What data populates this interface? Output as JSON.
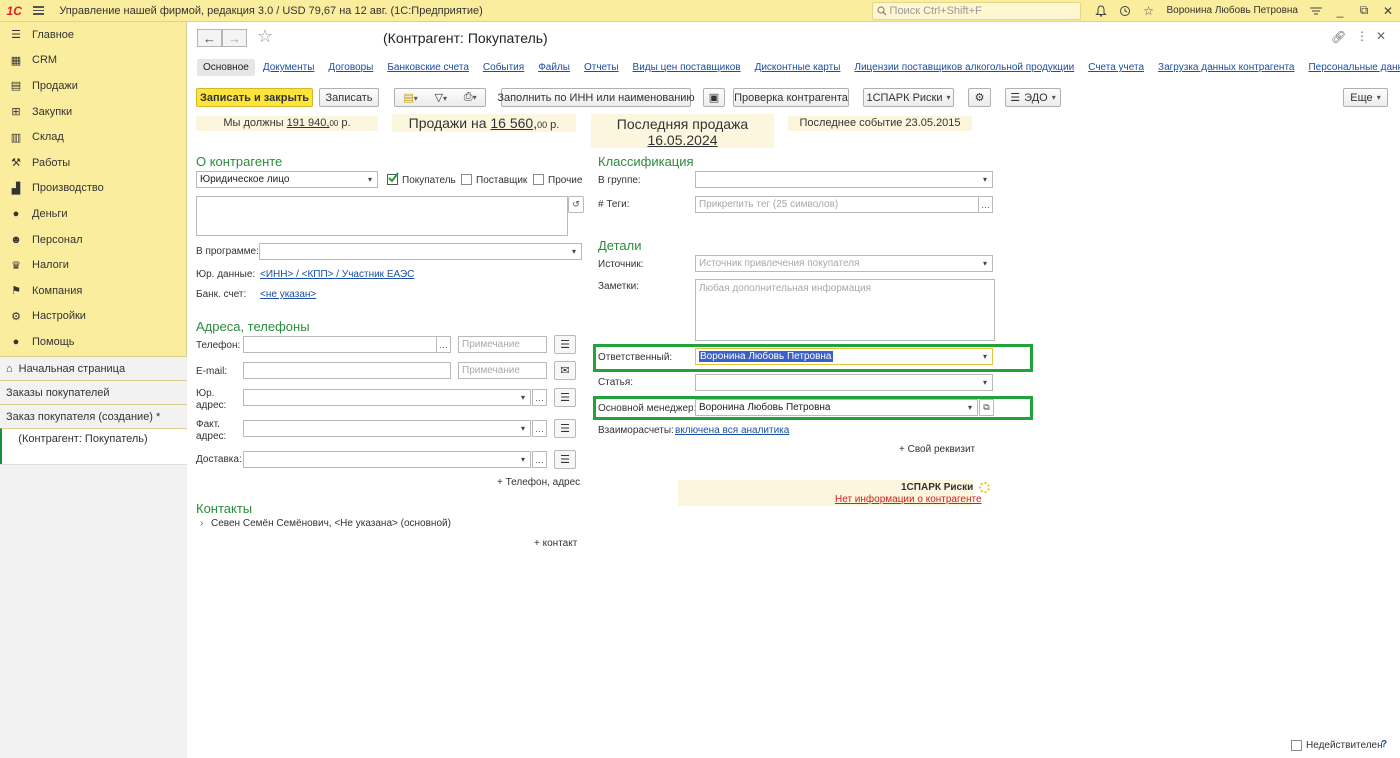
{
  "topbar": {
    "logo": "1С",
    "app_title": "Управление нашей фирмой, редакция 3.0 / USD 79,67 на 12 авг.  (1С:Предприятие)",
    "search_placeholder": "Поиск Ctrl+Shift+F",
    "user_name": "Воронина Любовь Петровна"
  },
  "sidebar": {
    "items": [
      {
        "label": "Главное",
        "icon": "menu-icon"
      },
      {
        "label": "CRM",
        "icon": "crm-icon"
      },
      {
        "label": "Продажи",
        "icon": "sales-icon"
      },
      {
        "label": "Закупки",
        "icon": "purchases-icon"
      },
      {
        "label": "Склад",
        "icon": "warehouse-icon"
      },
      {
        "label": "Работы",
        "icon": "works-icon"
      },
      {
        "label": "Производство",
        "icon": "factory-icon"
      },
      {
        "label": "Деньги",
        "icon": "money-icon"
      },
      {
        "label": "Персонал",
        "icon": "staff-icon"
      },
      {
        "label": "Налоги",
        "icon": "taxes-icon"
      },
      {
        "label": "Компания",
        "icon": "company-icon"
      },
      {
        "label": "Настройки",
        "icon": "settings-icon"
      },
      {
        "label": "Помощь",
        "icon": "help-icon"
      }
    ],
    "open_windows": {
      "home": "Начальная страница",
      "w1": "Заказы покупателей",
      "w2": "Заказ покупателя (создание) *",
      "w3": "(Контрагент: Покупатель)"
    }
  },
  "form": {
    "title": "(Контрагент: Покупатель)",
    "tabs": [
      "Основное",
      "Документы",
      "Договоры",
      "Банковские счета",
      "События",
      "Файлы",
      "Отчеты",
      "Виды цен поставщиков",
      "Дисконтные карты",
      "Лицензии поставщиков алкогольной продукции",
      "Счета учета",
      "Загрузка данных контрагента",
      "Персональные данные"
    ],
    "toolbar": {
      "save_close": "Записать и закрыть",
      "save": "Записать",
      "fill_inn": "Заполнить по ИНН или наименованию",
      "check": "Проверка контрагента",
      "spark": "1СПАРК Риски",
      "edo": "ЭДО",
      "more": "Еще"
    },
    "stats": {
      "we_owe_label": "Мы должны",
      "we_owe_value": "191 940,",
      "we_owe_kop": "00",
      "we_owe_cur": " р.",
      "sales_label": "Продажи на",
      "sales_value": "16 560,",
      "sales_kop": "00",
      "sales_cur": " р.",
      "last_sale_label": "Последняя продажа",
      "last_sale_date": "16.05.2024",
      "last_event": "Последнее событие 23.05.2015"
    },
    "about": {
      "header": "О контрагенте",
      "type": "Юридическое лицо",
      "buyer": "Покупатель",
      "supplier": "Поставщик",
      "other": "Прочие",
      "program_label": "В программе:",
      "legal_label": "Юр. данные:",
      "legal_link": "<ИНН> / <КПП> / Участник ЕАЭС",
      "bank_label": "Банк. счет:",
      "bank_link": "<не указан>"
    },
    "contacts_block": {
      "header": "Адреса, телефоны",
      "phone_label": "Телефон:",
      "email_label": "E-mail:",
      "legal_addr_label": "Юр. адрес:",
      "fact_addr_label": "Факт. адрес:",
      "delivery_label": "Доставка:",
      "note_placeholder": "Примечание",
      "add_phone": "+ Телефон, адрес"
    },
    "contacts": {
      "header": "Контакты",
      "item": "Севен Семён Семёнович, <Не указана> (основной)",
      "add": "+ контакт"
    },
    "classification": {
      "header": "Классификация",
      "group_label": "В группе:",
      "tags_label": "#  Теги:",
      "tags_placeholder": "Прикрепить тег (25 символов)"
    },
    "details": {
      "header": "Детали",
      "source_label": "Источник:",
      "source_placeholder": "Источник привлечения покупателя",
      "notes_label": "Заметки:",
      "notes_placeholder": "Любая дополнительная информация",
      "responsible_label": "Ответственный:",
      "responsible_value": "Воронина Любовь Петровна",
      "article_label": "Статья:",
      "manager_label": "Основной менеджер:",
      "manager_value": "Воронина Любовь Петровна",
      "settlements_label": "Взаиморасчеты:",
      "settlements_link": "включена вся аналитика",
      "own_attr": "+ Свой реквизит"
    },
    "spark_panel": {
      "title": "1СПАРК Риски",
      "no_info": "Нет информации о контрагенте"
    },
    "inactive": "Недействителен",
    "help": "?"
  },
  "colors": {
    "sidebar_bg": "#fbed9e",
    "section_green": "#2e8b3d",
    "highlight_green": "#1fa33a",
    "link_blue": "#1a4fa3",
    "primary_yellow": "#fde43b"
  }
}
